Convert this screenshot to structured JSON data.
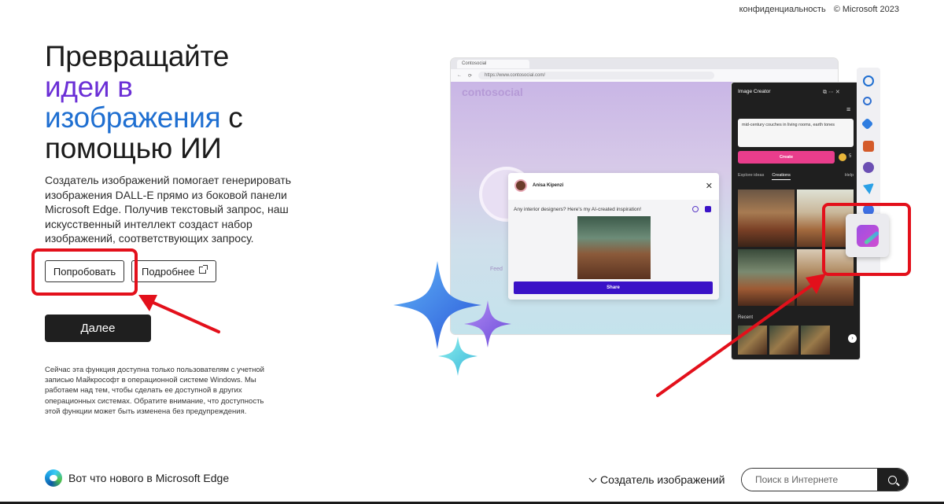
{
  "top_links": {
    "privacy": "конфиденциальность",
    "copyright": "© Microsoft 2023"
  },
  "hero": {
    "line1": "Превращайте",
    "line2_purple": "идеи в",
    "line3_blue": "изображения",
    "line3_rest": " с",
    "line4": "помощью ИИ"
  },
  "description": "Создатель изображений помогает генерировать изображения DALL-E прямо из боковой панели Microsoft Edge. Получив текстовый запрос, наш искусственный интеллект создаст набор изображений, соответствующих запросу.",
  "buttons": {
    "try_label": "Попробовать",
    "learn_more_label": "Подробнее",
    "next_label": "Далее"
  },
  "note": "Сейчас эта функция доступна только пользователям с учетной записью Майкрософт в операционной системе Windows. Мы работаем над тем, чтобы сделать ее доступной в других операционных системах. Обратите внимание, что доступность этой функции может быть изменена без предупреждения.",
  "footer": {
    "whats_new": "Вот что нового в Microsoft Edge",
    "section_label": "Создатель изображений",
    "search_placeholder": "Поиск в Интернете"
  },
  "illustration": {
    "tab_title": "Contosocial",
    "url": "https://www.contosocial.com/",
    "site_logo": "contosocial",
    "feed_tab": "Feed",
    "chat_user": "Anisa Kipenzi",
    "chat_message": "Any interior designers? Here's my AI-created inspiration!",
    "share_label": "Share",
    "panel_title": "Image Creator",
    "prompt_text": "mid-century couches in living rooms, earth tones",
    "create_label": "Create",
    "coins": "5",
    "tab_explore": "Explore ideas",
    "tab_creations": "Creations",
    "help_label": "Help",
    "recent_label": "Recent"
  },
  "colors": {
    "accent_purple": "#6b2fd6",
    "accent_blue": "#1f6fd1",
    "annotation_red": "#e3101b",
    "dark_button": "#1f1f1f"
  }
}
